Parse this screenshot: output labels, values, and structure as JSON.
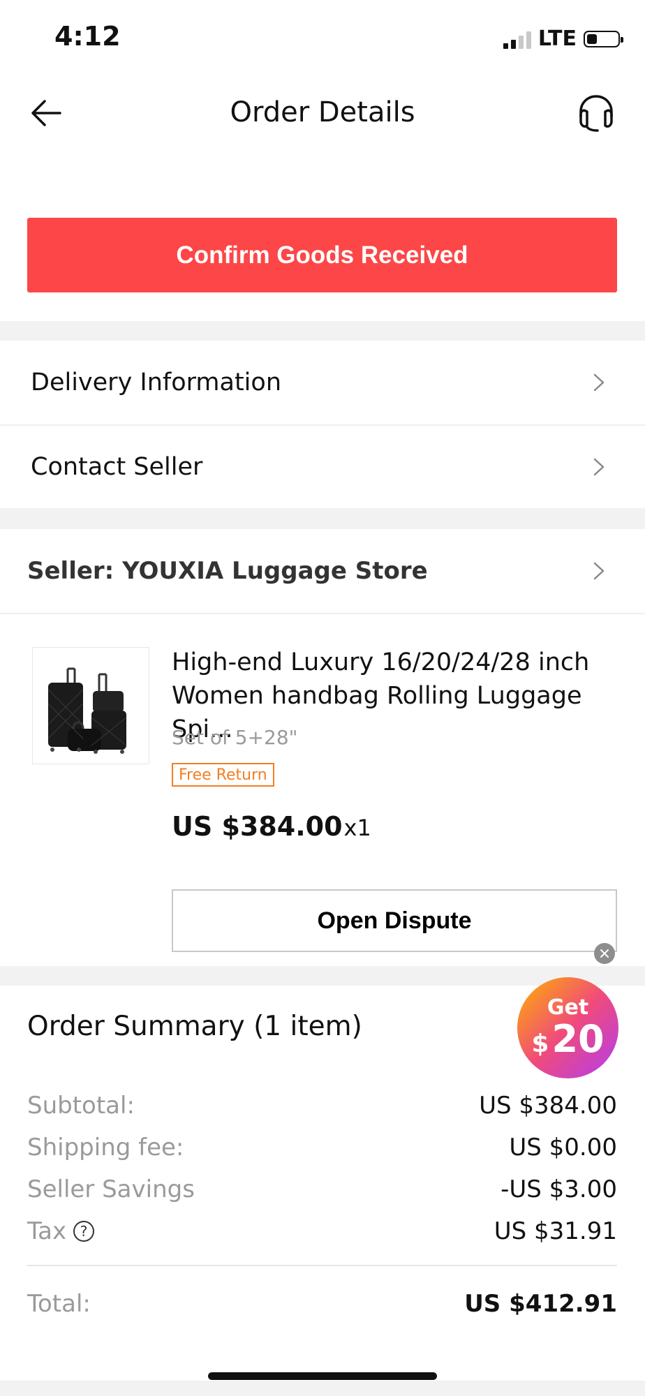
{
  "status_bar": {
    "time": "4:12",
    "network": "LTE"
  },
  "header": {
    "title": "Order Details",
    "back_icon": "arrow-left-icon",
    "support_icon": "headset-icon"
  },
  "actions": {
    "confirm_label": "Confirm Goods Received"
  },
  "menu": [
    {
      "label": "Delivery Information"
    },
    {
      "label": "Contact Seller"
    }
  ],
  "seller": {
    "label": "Seller: YOUXIA Luggage Store"
  },
  "product": {
    "title": "High-end Luxury 16/20/24/28 inch Women handbag Rolling Luggage Spi...",
    "sku": "Set of 5+28\"",
    "badge": "Free Return",
    "price": "US $384.00",
    "quantity": "x1",
    "dispute_label": "Open Dispute"
  },
  "promo": {
    "top": "Get",
    "currency": "$",
    "amount": "20"
  },
  "summary": {
    "title": "Order Summary (1 item)",
    "subtotal_label": "Subtotal:",
    "subtotal_value": "US $384.00",
    "shipping_label": "Shipping fee:",
    "shipping_value": "US $0.00",
    "savings_label": "Seller Savings",
    "savings_value": "-US $3.00",
    "tax_label": "Tax",
    "tax_help": "?",
    "tax_value": "US $31.91",
    "total_label": "Total:",
    "total_value": "US $412.91"
  },
  "colors": {
    "confirm_button": "#fd4647",
    "total": "#f0403b",
    "badge": "#f57d23"
  }
}
